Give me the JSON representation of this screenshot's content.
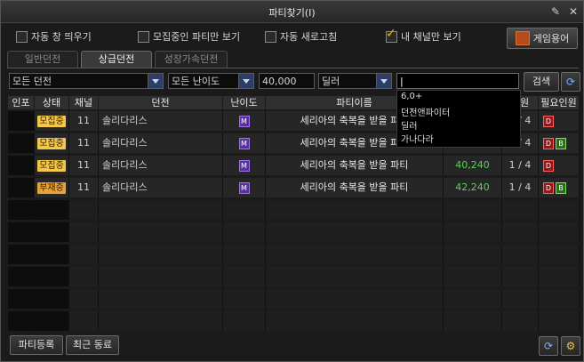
{
  "window": {
    "title": "파티찾기(I)"
  },
  "options": {
    "auto_popup": {
      "label": "자동 창 띄우기",
      "checked": false
    },
    "recruiting_only": {
      "label": "모집중인 파티만 보기",
      "checked": false
    },
    "auto_refresh": {
      "label": "자동 새로고침",
      "checked": false
    },
    "my_channel_only": {
      "label": "내 채널만 보기",
      "checked": true
    },
    "glossary_button": "게임용어"
  },
  "tabs": [
    {
      "label": "일반던전",
      "active": false
    },
    {
      "label": "상급던전",
      "active": true
    },
    {
      "label": "성장가속던전",
      "active": false
    }
  ],
  "filters": {
    "dungeon": "모든 던전",
    "difficulty": "모든 난이도",
    "fame": "40,000",
    "role": "딜러",
    "search_value": "",
    "search_button": "검색"
  },
  "autocomplete": [
    "6,0+",
    "던전앤파이터",
    "딜러",
    "가나다라"
  ],
  "table": {
    "headers": [
      "인포",
      "상태",
      "채널",
      "던전",
      "난이도",
      "파티이름",
      "",
      "인원",
      "필요인원"
    ],
    "rows": [
      {
        "status": "모집중",
        "status_type": "recruiting",
        "channel": "11",
        "dungeon": "솔리다리스",
        "difficulty": "M",
        "name": "세리아의 축복을 받을 파티",
        "fame": "",
        "members": "1 / 4",
        "needed": [
          "D"
        ]
      },
      {
        "status": "모집중",
        "status_type": "recruiting",
        "channel": "11",
        "dungeon": "솔리다리스",
        "difficulty": "M",
        "name": "세리아의 축복을 받을 파티",
        "fame": "",
        "members": "1 / 4",
        "needed": [
          "D",
          "B"
        ]
      },
      {
        "status": "모집중",
        "status_type": "recruiting",
        "channel": "11",
        "dungeon": "솔리다리스",
        "difficulty": "M",
        "name": "세리아의 축복을 받을 파티",
        "fame": "40,240",
        "members": "1 / 4",
        "needed": [
          "D"
        ]
      },
      {
        "status": "부재중",
        "status_type": "absent",
        "channel": "11",
        "dungeon": "솔리다리스",
        "difficulty": "M",
        "name": "세리아의 축복을 받을 파티",
        "fame": "42,240",
        "members": "1 / 4",
        "needed": [
          "D",
          "B"
        ]
      }
    ],
    "empty_rows": 6
  },
  "bottom": {
    "register_button": "파티등록",
    "recent_button": "최근 동료"
  },
  "colors": {
    "fame_green": "#58d25a",
    "status_yellow": "#f2c84a",
    "accent_blue": "#2c3e66"
  }
}
